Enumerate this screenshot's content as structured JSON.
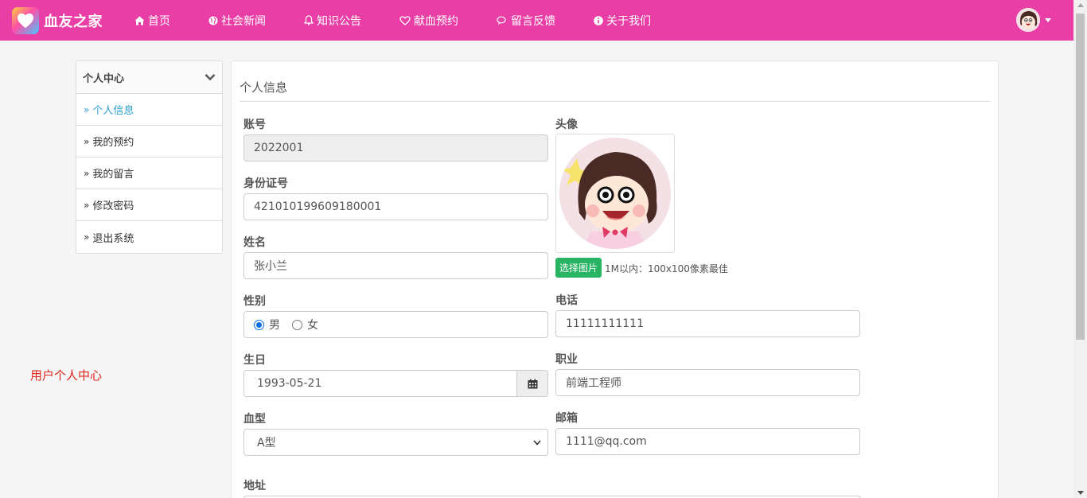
{
  "brand": {
    "title": "血友之家"
  },
  "nav": {
    "items": [
      {
        "label": "首页",
        "icon": "home-icon"
      },
      {
        "label": "社会新闻",
        "icon": "globe-icon"
      },
      {
        "label": "知识公告",
        "icon": "bell-icon"
      },
      {
        "label": "献血预约",
        "icon": "heart-icon"
      },
      {
        "label": "留言反馈",
        "icon": "comments-icon"
      },
      {
        "label": "关于我们",
        "icon": "info-circle-icon"
      }
    ]
  },
  "sidebar": {
    "header": "个人中心",
    "items": [
      {
        "label": "个人信息",
        "active": true
      },
      {
        "label": "我的预约"
      },
      {
        "label": "我的留言"
      },
      {
        "label": "修改密码"
      },
      {
        "label": "退出系统"
      }
    ]
  },
  "page_note": "用户个人中心",
  "panel": {
    "title": "个人信息"
  },
  "form": {
    "account": {
      "label": "账号",
      "value": "2022001"
    },
    "id_card": {
      "label": "身份证号",
      "value": "421010199609180001"
    },
    "name": {
      "label": "姓名",
      "value": "张小兰"
    },
    "gender": {
      "label": "性别",
      "options": [
        "男",
        "女"
      ],
      "selected": "男"
    },
    "birthday": {
      "label": "生日",
      "value": "1993-05-21"
    },
    "blood_type": {
      "label": "血型",
      "value": "A型"
    },
    "address": {
      "label": "地址"
    },
    "avatar": {
      "label": "头像",
      "button": "选择图片",
      "hint": "1M以内：100x100像素最佳"
    },
    "phone": {
      "label": "电话",
      "value": "11111111111"
    },
    "job": {
      "label": "职业",
      "value": "前端工程师"
    },
    "email": {
      "label": "邮箱",
      "value": "1111@qq.com"
    }
  },
  "colors": {
    "navbar": "#e83ea5",
    "active_link": "#2a9fd6",
    "note": "#e2231a",
    "pick_button": "#28b463"
  }
}
